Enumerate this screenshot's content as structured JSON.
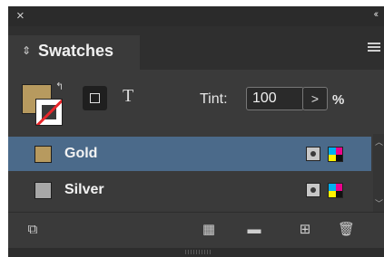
{
  "window": {
    "close_icon": "×",
    "collapse_icon": "‹‹"
  },
  "panel": {
    "title": "Swatches",
    "menu_icon": "hamburger-icon"
  },
  "tint": {
    "label": "Tint:",
    "value": "100",
    "unit": "%",
    "stepper": ">"
  },
  "formatting": {
    "text_button": "T"
  },
  "swatches": [
    {
      "name": "Gold",
      "color": "#b79a5f",
      "selected": true
    },
    {
      "name": "Silver",
      "color": "#a7a7a7",
      "selected": false
    }
  ],
  "colors": {
    "selection": "#4b6a8a",
    "stroke_none_red": "#e8262a",
    "fill": "#b79a5f"
  },
  "icons": [
    "swap-fill-stroke-icon",
    "container-format-icon",
    "text-format-icon",
    "spot-color-icon",
    "cmyk-process-icon",
    "show-swatch-kinds-icon",
    "new-color-group-icon",
    "folder-icon",
    "new-swatch-icon",
    "delete-swatch-icon"
  ]
}
